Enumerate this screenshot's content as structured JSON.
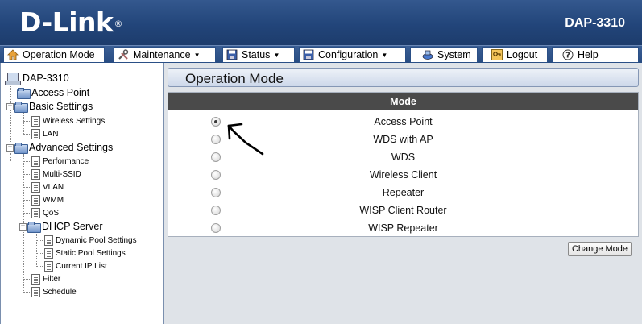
{
  "header": {
    "brand": "D-Link",
    "brand_mark": "®",
    "model": "DAP-3310"
  },
  "menu": {
    "items": [
      {
        "label": "Operation Mode",
        "icon": "home-icon",
        "dropdown": false
      },
      {
        "label": "Maintenance",
        "icon": "tools-icon",
        "dropdown": true
      },
      {
        "label": "Status",
        "icon": "floppy-icon",
        "dropdown": true
      },
      {
        "label": "Configuration",
        "icon": "floppy-icon",
        "dropdown": true
      },
      {
        "label": "System",
        "icon": "system-icon",
        "dropdown": false
      },
      {
        "label": "Logout",
        "icon": "key-icon",
        "dropdown": false
      },
      {
        "label": "Help",
        "icon": "help-icon",
        "dropdown": false
      }
    ]
  },
  "sidebar": {
    "root": "DAP-3310",
    "items": {
      "access_point": "Access Point",
      "basic_settings": "Basic Settings",
      "wireless_settings": "Wireless Settings",
      "lan": "LAN",
      "advanced_settings": "Advanced Settings",
      "performance": "Performance",
      "multi_ssid": "Multi-SSID",
      "vlan": "VLAN",
      "wmm": "WMM",
      "qos": "QoS",
      "dhcp_server": "DHCP Server",
      "dynamic_pool": "Dynamic Pool Settings",
      "static_pool": "Static Pool Settings",
      "current_ip": "Current IP List",
      "filter": "Filter",
      "schedule": "Schedule"
    }
  },
  "main": {
    "title": "Operation Mode",
    "table_header": "Mode",
    "modes": [
      {
        "label": "Access Point",
        "selected": true
      },
      {
        "label": "WDS with AP",
        "selected": false
      },
      {
        "label": "WDS",
        "selected": false
      },
      {
        "label": "Wireless Client",
        "selected": false
      },
      {
        "label": "Repeater",
        "selected": false
      },
      {
        "label": "WISP Client Router",
        "selected": false
      },
      {
        "label": "WISP Repeater",
        "selected": false
      }
    ],
    "change_button": "Change Mode"
  },
  "colors": {
    "header_bg": "#22457a",
    "table_head_bg": "#4a4a4a",
    "main_bg": "#dfe3e8"
  }
}
